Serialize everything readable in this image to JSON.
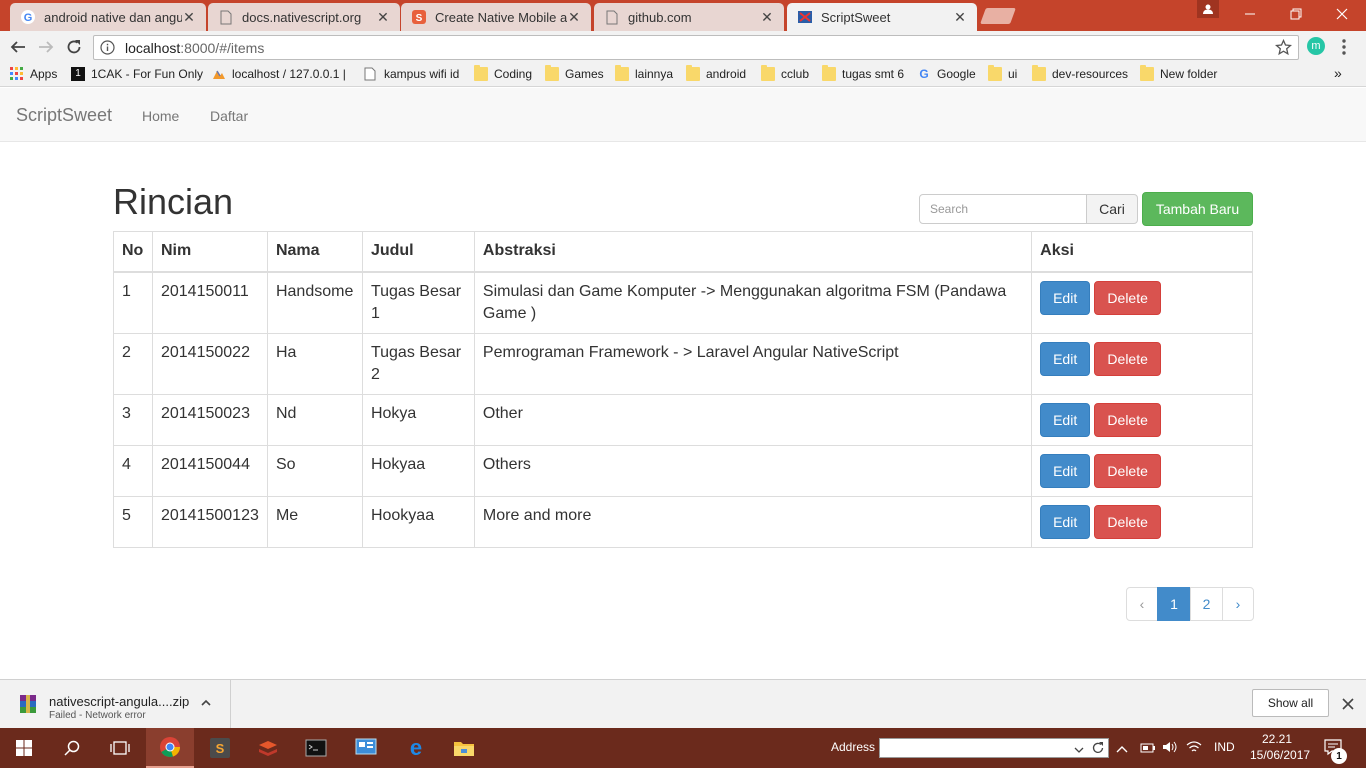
{
  "browser": {
    "tabs": [
      {
        "title": "android native dan angu",
        "icon": "google-icon"
      },
      {
        "title": "docs.nativescript.org",
        "icon": "page-icon"
      },
      {
        "title": "Create Native Mobile and",
        "icon": "nativescript-icon"
      },
      {
        "title": "github.com",
        "icon": "page-icon"
      },
      {
        "title": "ScriptSweet",
        "icon": "scriptsweet-icon"
      }
    ],
    "address": {
      "host": "localhost",
      "path": ":8000/#/items"
    },
    "profile_initial": "m",
    "bookmarks": [
      {
        "label": "Apps",
        "icon": "apps-grid-icon"
      },
      {
        "label": "1CAK - For Fun Only",
        "icon": "onecak-icon"
      },
      {
        "label": "localhost / 127.0.0.1 |",
        "icon": "phpmyadmin-icon"
      },
      {
        "label": "kampus wifi id",
        "icon": "page-icon"
      },
      {
        "label": "Coding",
        "icon": "folder-icon"
      },
      {
        "label": "Games",
        "icon": "folder-icon"
      },
      {
        "label": "lainnya",
        "icon": "folder-icon"
      },
      {
        "label": "android",
        "icon": "folder-icon"
      },
      {
        "label": "cclub",
        "icon": "folder-icon"
      },
      {
        "label": "tugas smt 6",
        "icon": "folder-icon"
      },
      {
        "label": "Google",
        "icon": "google-icon"
      },
      {
        "label": "ui",
        "icon": "folder-icon"
      },
      {
        "label": "dev-resources",
        "icon": "folder-icon"
      },
      {
        "label": "New folder",
        "icon": "folder-icon"
      }
    ],
    "overflow": "»"
  },
  "app": {
    "brand": "ScriptSweet",
    "nav": [
      "Home",
      "Daftar"
    ],
    "heading": "Rincian",
    "search_placeholder": "Search",
    "search_button": "Cari",
    "add_button": "Tambah Baru",
    "columns": [
      "No",
      "Nim",
      "Nama",
      "Judul",
      "Abstraksi",
      "Aksi"
    ],
    "rows": [
      {
        "no": "1",
        "nim": "2014150011",
        "nama": "Handsome",
        "judul": "Tugas Besar 1",
        "abstraksi": "Simulasi dan Game Komputer -> Menggunakan algoritma FSM (Pandawa Game )"
      },
      {
        "no": "2",
        "nim": "2014150022",
        "nama": "Ha",
        "judul": "Tugas Besar 2",
        "abstraksi": "Pemrograman Framework - > Laravel Angular NativeScript"
      },
      {
        "no": "3",
        "nim": "2014150023",
        "nama": "Nd",
        "judul": "Hokya",
        "abstraksi": "Other"
      },
      {
        "no": "4",
        "nim": "2014150044",
        "nama": "So",
        "judul": "Hokyaa",
        "abstraksi": "Others"
      },
      {
        "no": "5",
        "nim": "20141500123",
        "nama": "Me",
        "judul": "Hookyaa",
        "abstraksi": "More and more"
      }
    ],
    "edit_label": "Edit",
    "delete_label": "Delete",
    "pagination": {
      "prev": "‹",
      "pages": [
        "1",
        "2"
      ],
      "current": "1",
      "next": "›"
    }
  },
  "download": {
    "filename": "nativescript-angula....zip",
    "status": "Failed - Network error",
    "show_all": "Show all"
  },
  "taskbar": {
    "address_label": "Address",
    "language": "IND",
    "time": "22.21",
    "date": "15/06/2017",
    "notification_count": "1"
  },
  "colors": {
    "titlebar": "#c5442b",
    "taskbar": "#6b2a1c",
    "primary": "#428bca",
    "success": "#5cb85c",
    "danger": "#d9534f"
  }
}
